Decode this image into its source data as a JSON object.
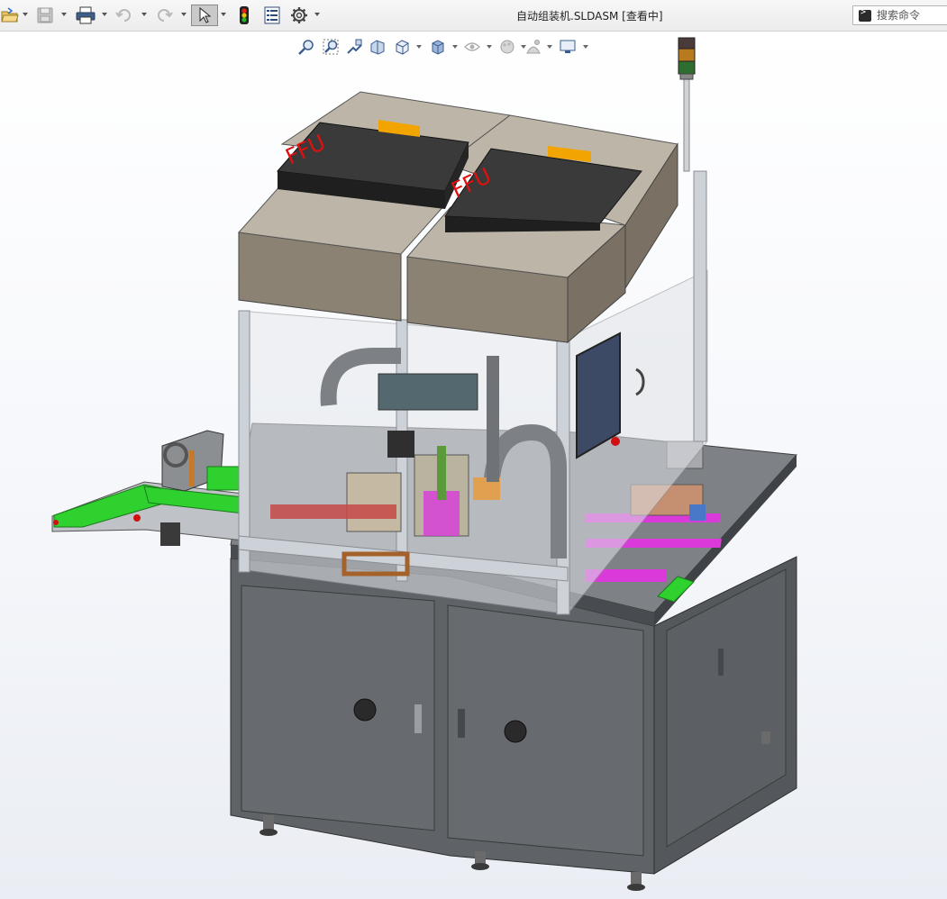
{
  "window": {
    "title": "自动组装机.SLDASM [查看中]"
  },
  "search": {
    "placeholder": "搜索命令"
  },
  "toolbar": {
    "icons": [
      "open-icon",
      "save-icon",
      "print-icon",
      "undo-icon",
      "redo-icon",
      "select-arrow-icon",
      "traffic-light-icon",
      "file-properties-icon",
      "options-gear-icon"
    ]
  },
  "view_toolbar": {
    "icons": [
      "zoom-to-fit-icon",
      "zoom-to-area-icon",
      "previous-view-icon",
      "section-view-icon",
      "view-orientation-icon",
      "display-style-icon",
      "hide-show-items-icon",
      "edit-appearance-icon",
      "apply-scene-icon",
      "view-settings-icon"
    ]
  },
  "model": {
    "label_left": "FFU",
    "label_right": "FFU"
  },
  "colors": {
    "accent_green": "#2fd12f",
    "accent_orange": "#f2a400",
    "accent_magenta": "#d93ad9",
    "cabinet_gray": "#5f6367",
    "panel_tan": "#bdb6a8",
    "ffu_black": "#2d2d2d",
    "ffu_label_red": "#e01010"
  }
}
